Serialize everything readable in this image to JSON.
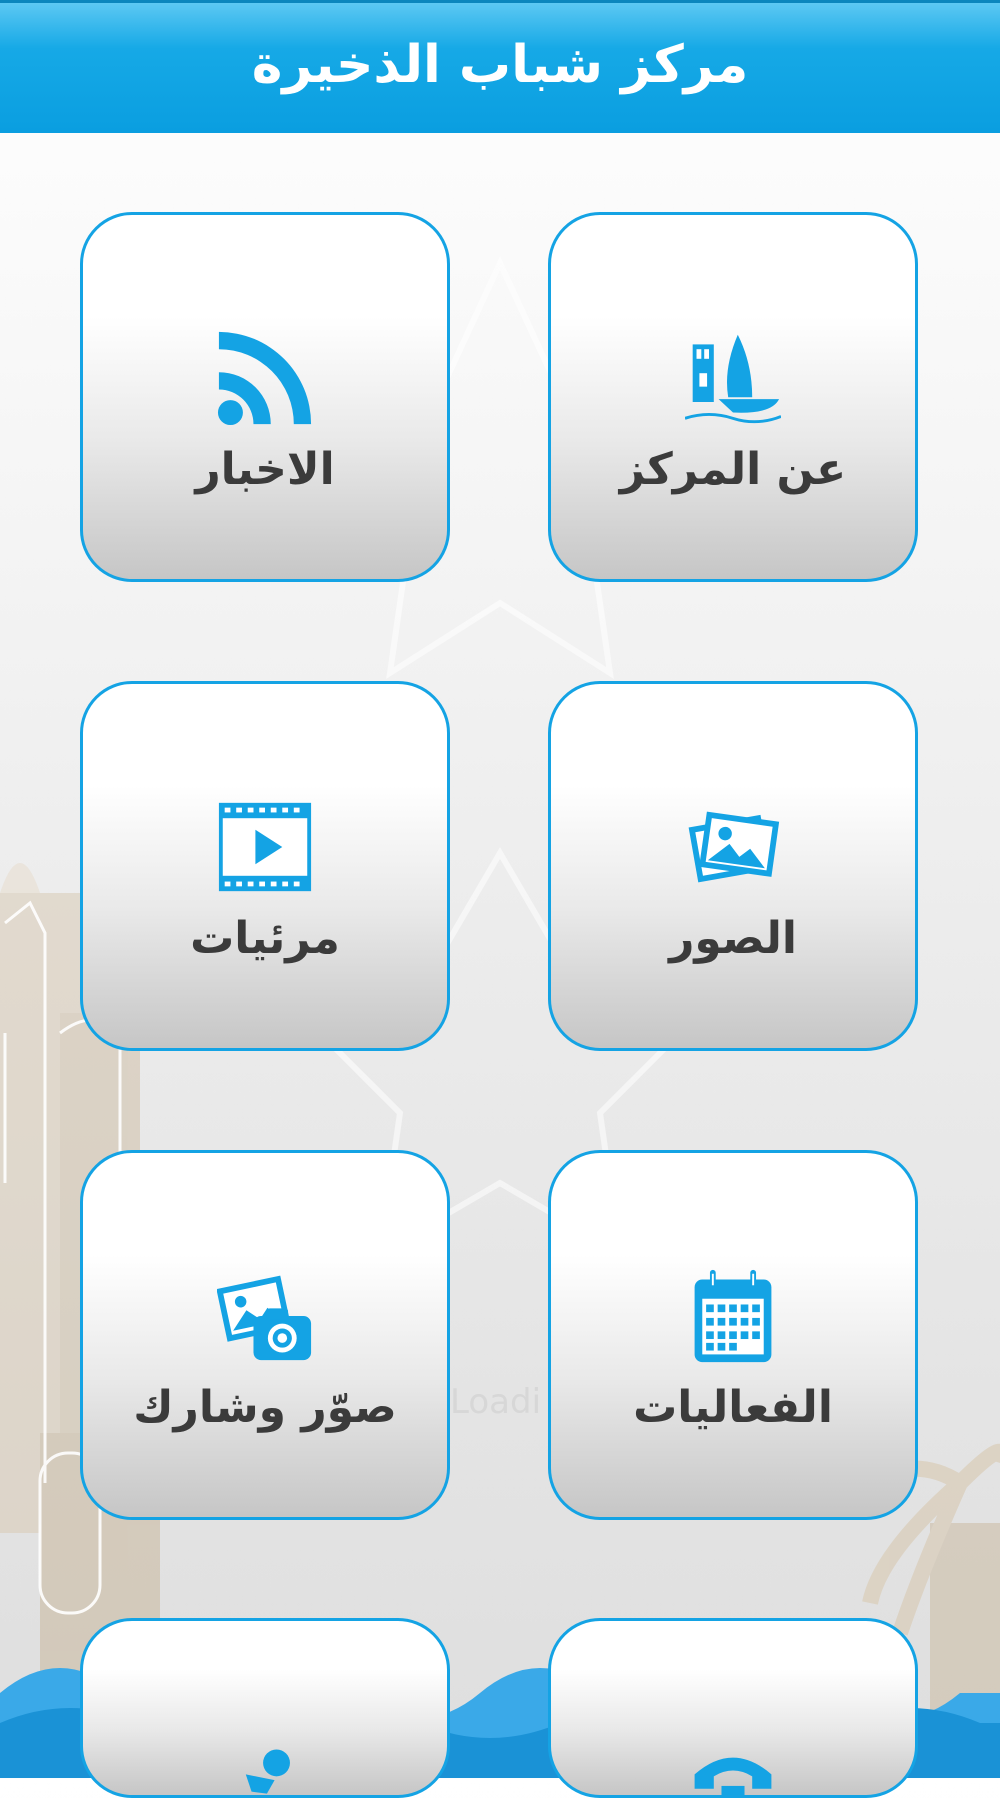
{
  "header": {
    "title": "مركز شباب الذخيرة"
  },
  "background": {
    "loading_text": "Loadi"
  },
  "colors": {
    "accent": "#0a9ee0",
    "tile_border": "#14a3e4",
    "label_text": "#3b3b3b"
  },
  "tiles": [
    {
      "label": "عن المركز",
      "icon": "boat-tower-icon"
    },
    {
      "label": "الاخبار",
      "icon": "rss-feed-icon"
    },
    {
      "label": "الصور",
      "icon": "photos-icon"
    },
    {
      "label": "مرئيات",
      "icon": "video-film-icon"
    },
    {
      "label": "الفعاليات",
      "icon": "calendar-icon"
    },
    {
      "label": "صوّر وشارك",
      "icon": "camera-share-icon"
    },
    {
      "label": "",
      "icon": "phone-icon"
    },
    {
      "label": "",
      "icon": "person-icon"
    }
  ]
}
